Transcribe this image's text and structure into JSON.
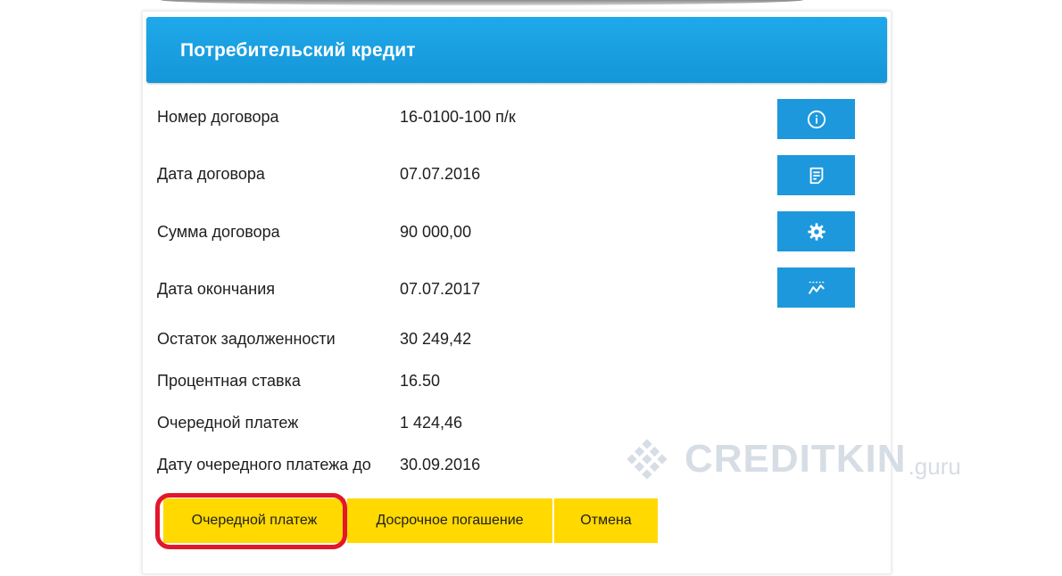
{
  "card": {
    "title": "Потребительский кредит"
  },
  "details": [
    {
      "label": "Номер договора",
      "value": "16-0100-100 п/к"
    },
    {
      "label": "Дата договора",
      "value": "07.07.2016"
    },
    {
      "label": "Сумма договора",
      "value": "90 000,00"
    },
    {
      "label": "Дата окончания",
      "value": "07.07.2017"
    },
    {
      "label": "Остаток задолженности",
      "value": "30 249,42"
    },
    {
      "label": "Процентная ставка",
      "value": "16.50"
    },
    {
      "label": "Очередной платеж",
      "value": "1 424,46"
    },
    {
      "label": "Дату очередного платежа до",
      "value": "30.09.2016"
    }
  ],
  "side_buttons": [
    {
      "icon": "info-icon"
    },
    {
      "icon": "document-icon"
    },
    {
      "icon": "gear-icon"
    },
    {
      "icon": "chart-icon"
    }
  ],
  "actions": {
    "next_payment": "Очередной платеж",
    "early_repayment": "Досрочное погашение",
    "cancel": "Отмена"
  },
  "watermark": {
    "text": "CREDITKIN",
    "suffix": ".guru"
  },
  "colors": {
    "header_blue": "#1596d8",
    "button_blue": "#1d98dc",
    "action_yellow": "#ffd900",
    "highlight_red": "#e3162c"
  }
}
